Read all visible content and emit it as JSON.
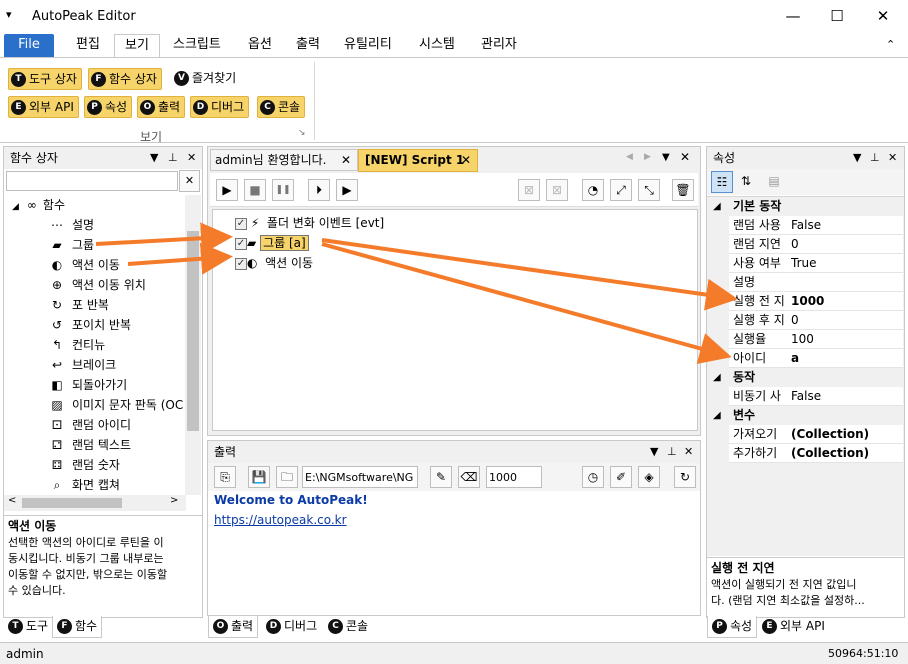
{
  "window": {
    "title": "AutoPeak Editor",
    "qa_icon": "▾",
    "minimize": "—",
    "maximize": "☐",
    "close": "✕"
  },
  "ribbon_tabs": [
    "File",
    "편집",
    "보기",
    "스크립트",
    "옵션",
    "출력",
    "유틸리티",
    "시스템",
    "관리자"
  ],
  "ribbon_collapse": "⌃",
  "ribbon": {
    "row1": [
      {
        "badge": "T",
        "label": "도구 상자"
      },
      {
        "badge": "F",
        "label": "함수 상자"
      },
      {
        "badge": "V",
        "label": "즐겨찾기"
      }
    ],
    "row2": [
      {
        "badge": "E",
        "label": "외부 API"
      },
      {
        "badge": "P",
        "label": "속성"
      },
      {
        "badge": "O",
        "label": "출력"
      },
      {
        "badge": "D",
        "label": "디버그"
      },
      {
        "badge": "C",
        "label": "콘솔"
      }
    ],
    "group_label": "보기",
    "launcher": "↘"
  },
  "function_box": {
    "title": "함수 상자",
    "pin": "📌",
    "close": "✕",
    "dropdown": "▼",
    "search_value": "",
    "search_clear": "✕",
    "root_label": "함수",
    "items": [
      {
        "icon": "⋯",
        "label": "설명"
      },
      {
        "icon": "▰",
        "label": "그룹"
      },
      {
        "icon": "◐",
        "label": "액션 이동"
      },
      {
        "icon": "⊕",
        "label": "액션 이동 위치"
      },
      {
        "icon": "↻",
        "label": "포 반복"
      },
      {
        "icon": "↺",
        "label": "포이치 반복"
      },
      {
        "icon": "↰",
        "label": "컨티뉴"
      },
      {
        "icon": "↩",
        "label": "브레이크"
      },
      {
        "icon": "◧",
        "label": "되돌아가기"
      },
      {
        "icon": "▨",
        "label": "이미지 문자 판독 (OC"
      },
      {
        "icon": "⚀",
        "label": "랜덤 아이디"
      },
      {
        "icon": "⚁",
        "label": "랜덤 텍스트"
      },
      {
        "icon": "⚃",
        "label": "랜덤 숫자"
      },
      {
        "icon": "⌕",
        "label": "화면 캡쳐"
      }
    ],
    "desc_title": "액션 이동",
    "desc_lines": [
      "선택한 액션의 아이디로 루틴을 이",
      "동시킵니다. 비동기 그룹 내부로는",
      "이동할 수 없지만, 밖으로는 이동할",
      "수 있습니다."
    ],
    "tabs": [
      {
        "badge": "T",
        "label": "도구"
      },
      {
        "badge": "F",
        "label": "함수"
      }
    ]
  },
  "editor": {
    "tabs": [
      {
        "label": "admin님 환영합니다.",
        "close": "✕"
      },
      {
        "label": "[NEW] Script 1",
        "close": "✕"
      }
    ],
    "nav": [
      "◀",
      "▶",
      "▼",
      "✕"
    ],
    "toolbar": [
      "▶",
      "■",
      "❚❚",
      "⏵",
      "▶",
      "⊠",
      "⊠",
      "◔",
      "⤢",
      "⤡",
      "🗑"
    ],
    "script": [
      {
        "check": "✓",
        "icon": "⚡",
        "label": "폴더 변화 이벤트 [evt]"
      },
      {
        "check": "✓",
        "icon": "▰",
        "label": "그룹 [a]"
      },
      {
        "check": "✓",
        "icon": "◐",
        "label": "액션 이동"
      }
    ]
  },
  "output": {
    "title": "출력",
    "path": "E:\\NGMsoftware\\NG",
    "count": "1000",
    "welcome": "Welcome to AutoPeak!",
    "url": "https://autopeak.co.kr",
    "tabs": [
      {
        "badge": "O",
        "label": "출력"
      },
      {
        "badge": "D",
        "label": "디버그"
      },
      {
        "badge": "C",
        "label": "콘솔"
      }
    ]
  },
  "properties": {
    "title": "속성",
    "categories": [
      {
        "name": "기본 동작",
        "rows": [
          {
            "k": "랜덤 사용",
            "v": "False",
            "bold": false
          },
          {
            "k": "랜덤 지연",
            "v": "0",
            "bold": false
          },
          {
            "k": "사용 여부",
            "v": "True",
            "bold": false
          },
          {
            "k": "설명",
            "v": "",
            "bold": false
          },
          {
            "k": "실행 전 지",
            "v": "1000",
            "bold": true
          },
          {
            "k": "실행 후 지",
            "v": "0",
            "bold": false
          },
          {
            "k": "실행율",
            "v": "100",
            "bold": false
          },
          {
            "k": "아이디",
            "v": "a",
            "bold": true
          }
        ]
      },
      {
        "name": "동작",
        "rows": [
          {
            "k": "비동기 사",
            "v": "False",
            "bold": false
          }
        ]
      },
      {
        "name": "변수",
        "rows": [
          {
            "k": "가져오기",
            "v": "(Collection)",
            "bold": true
          },
          {
            "k": "추가하기",
            "v": "(Collection)",
            "bold": true
          }
        ]
      }
    ],
    "desc_title": "실행 전 지연",
    "desc_lines": [
      "액션이 실행되기 전 지연 값입니",
      "다. (랜덤 지연 최소값을 설정하..."
    ],
    "tabs": [
      {
        "badge": "P",
        "label": "속성"
      },
      {
        "badge": "E",
        "label": "외부 API"
      }
    ]
  },
  "status": {
    "user": "admin",
    "clock": "50964:51:10"
  },
  "colors": {
    "file_tab": "#2a6fc9",
    "ribbon_button": "#f7d46a",
    "arrow": "#f47b2a",
    "link": "#0b3ba6"
  }
}
